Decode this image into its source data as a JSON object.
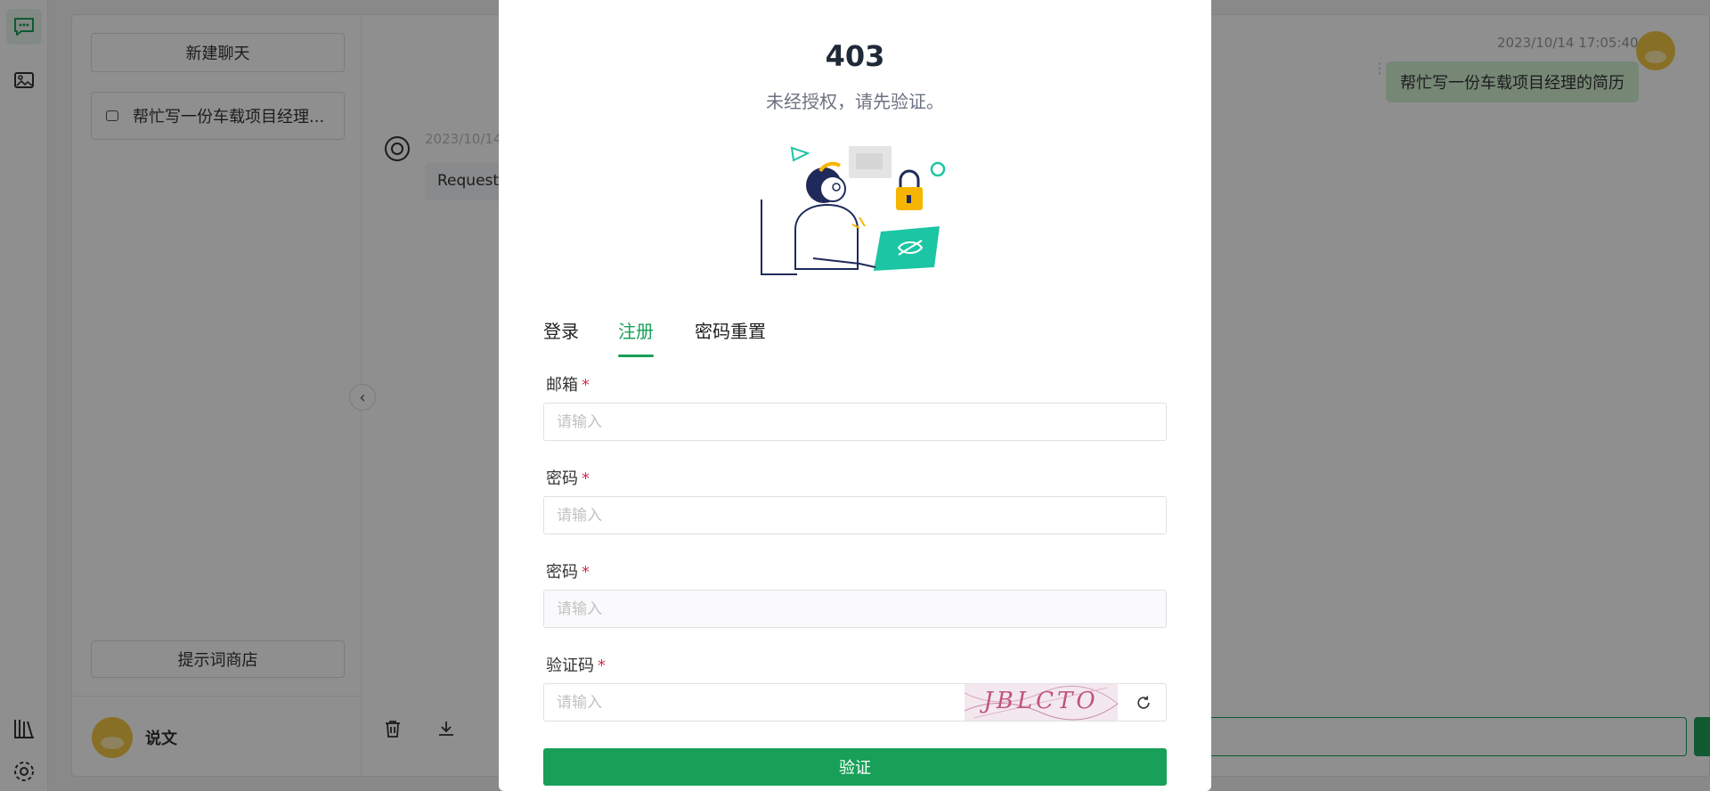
{
  "sidebar": {
    "new_chat_label": "新建聊天",
    "chat_items": [
      {
        "title": "帮忙写一份车载项目经理..."
      }
    ],
    "prompt_store_label": "提示词商店",
    "user_name": "说文"
  },
  "conversation": {
    "bot_time": "2023/10/14",
    "bot_message": "Request",
    "user_time": "2023/10/14 17:05:40",
    "user_message": "帮忙写一份车载项目经理的简历",
    "menu_glyph": "⋮"
  },
  "rail": {
    "icons": [
      "chat-icon",
      "image-icon",
      "library-icon",
      "settings-icon"
    ]
  },
  "modal": {
    "title": "403",
    "subtitle": "未经授权，请先验证。",
    "tabs": [
      "登录",
      "注册",
      "密码重置"
    ],
    "active_tab": 1,
    "fields": {
      "email_label": "邮箱",
      "email_placeholder": "请输入",
      "password_label": "密码",
      "password_placeholder": "请输入",
      "password2_label": "密码",
      "password2_placeholder": "请输入",
      "captcha_label": "验证码",
      "captcha_placeholder": "请输入",
      "captcha_text": "JBLCTO",
      "required_mark": "*"
    },
    "submit_label": "验证"
  },
  "colors": {
    "accent": "#18a058",
    "required": "#d03050",
    "user_bubble": "#d2f1d3",
    "overlay": "rgba(0,0,0,0.44)"
  }
}
